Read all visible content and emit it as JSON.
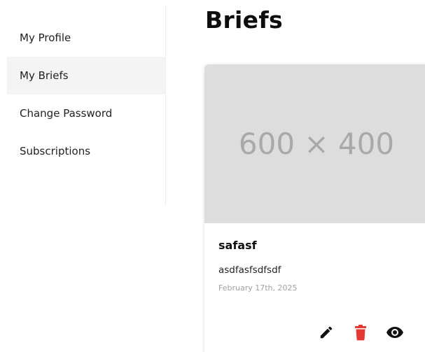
{
  "sidebar": {
    "items": [
      {
        "label": "My Profile",
        "active": false
      },
      {
        "label": "My Briefs",
        "active": true
      },
      {
        "label": "Change Password",
        "active": false
      },
      {
        "label": "Subscriptions",
        "active": false
      }
    ]
  },
  "main": {
    "title": "Briefs",
    "cards": [
      {
        "image_placeholder": "600 × 400",
        "title": "safasf",
        "description": "asdfasfsdfsdf",
        "date": "February 17th, 2025",
        "actions": {
          "edit_icon": "pencil-icon",
          "delete_icon": "trash-icon",
          "view_icon": "eye-icon"
        }
      }
    ]
  },
  "colors": {
    "delete": "#e53935",
    "icon": "#111111",
    "active_bg": "#f4f4f4",
    "placeholder_bg": "#dddddd"
  }
}
